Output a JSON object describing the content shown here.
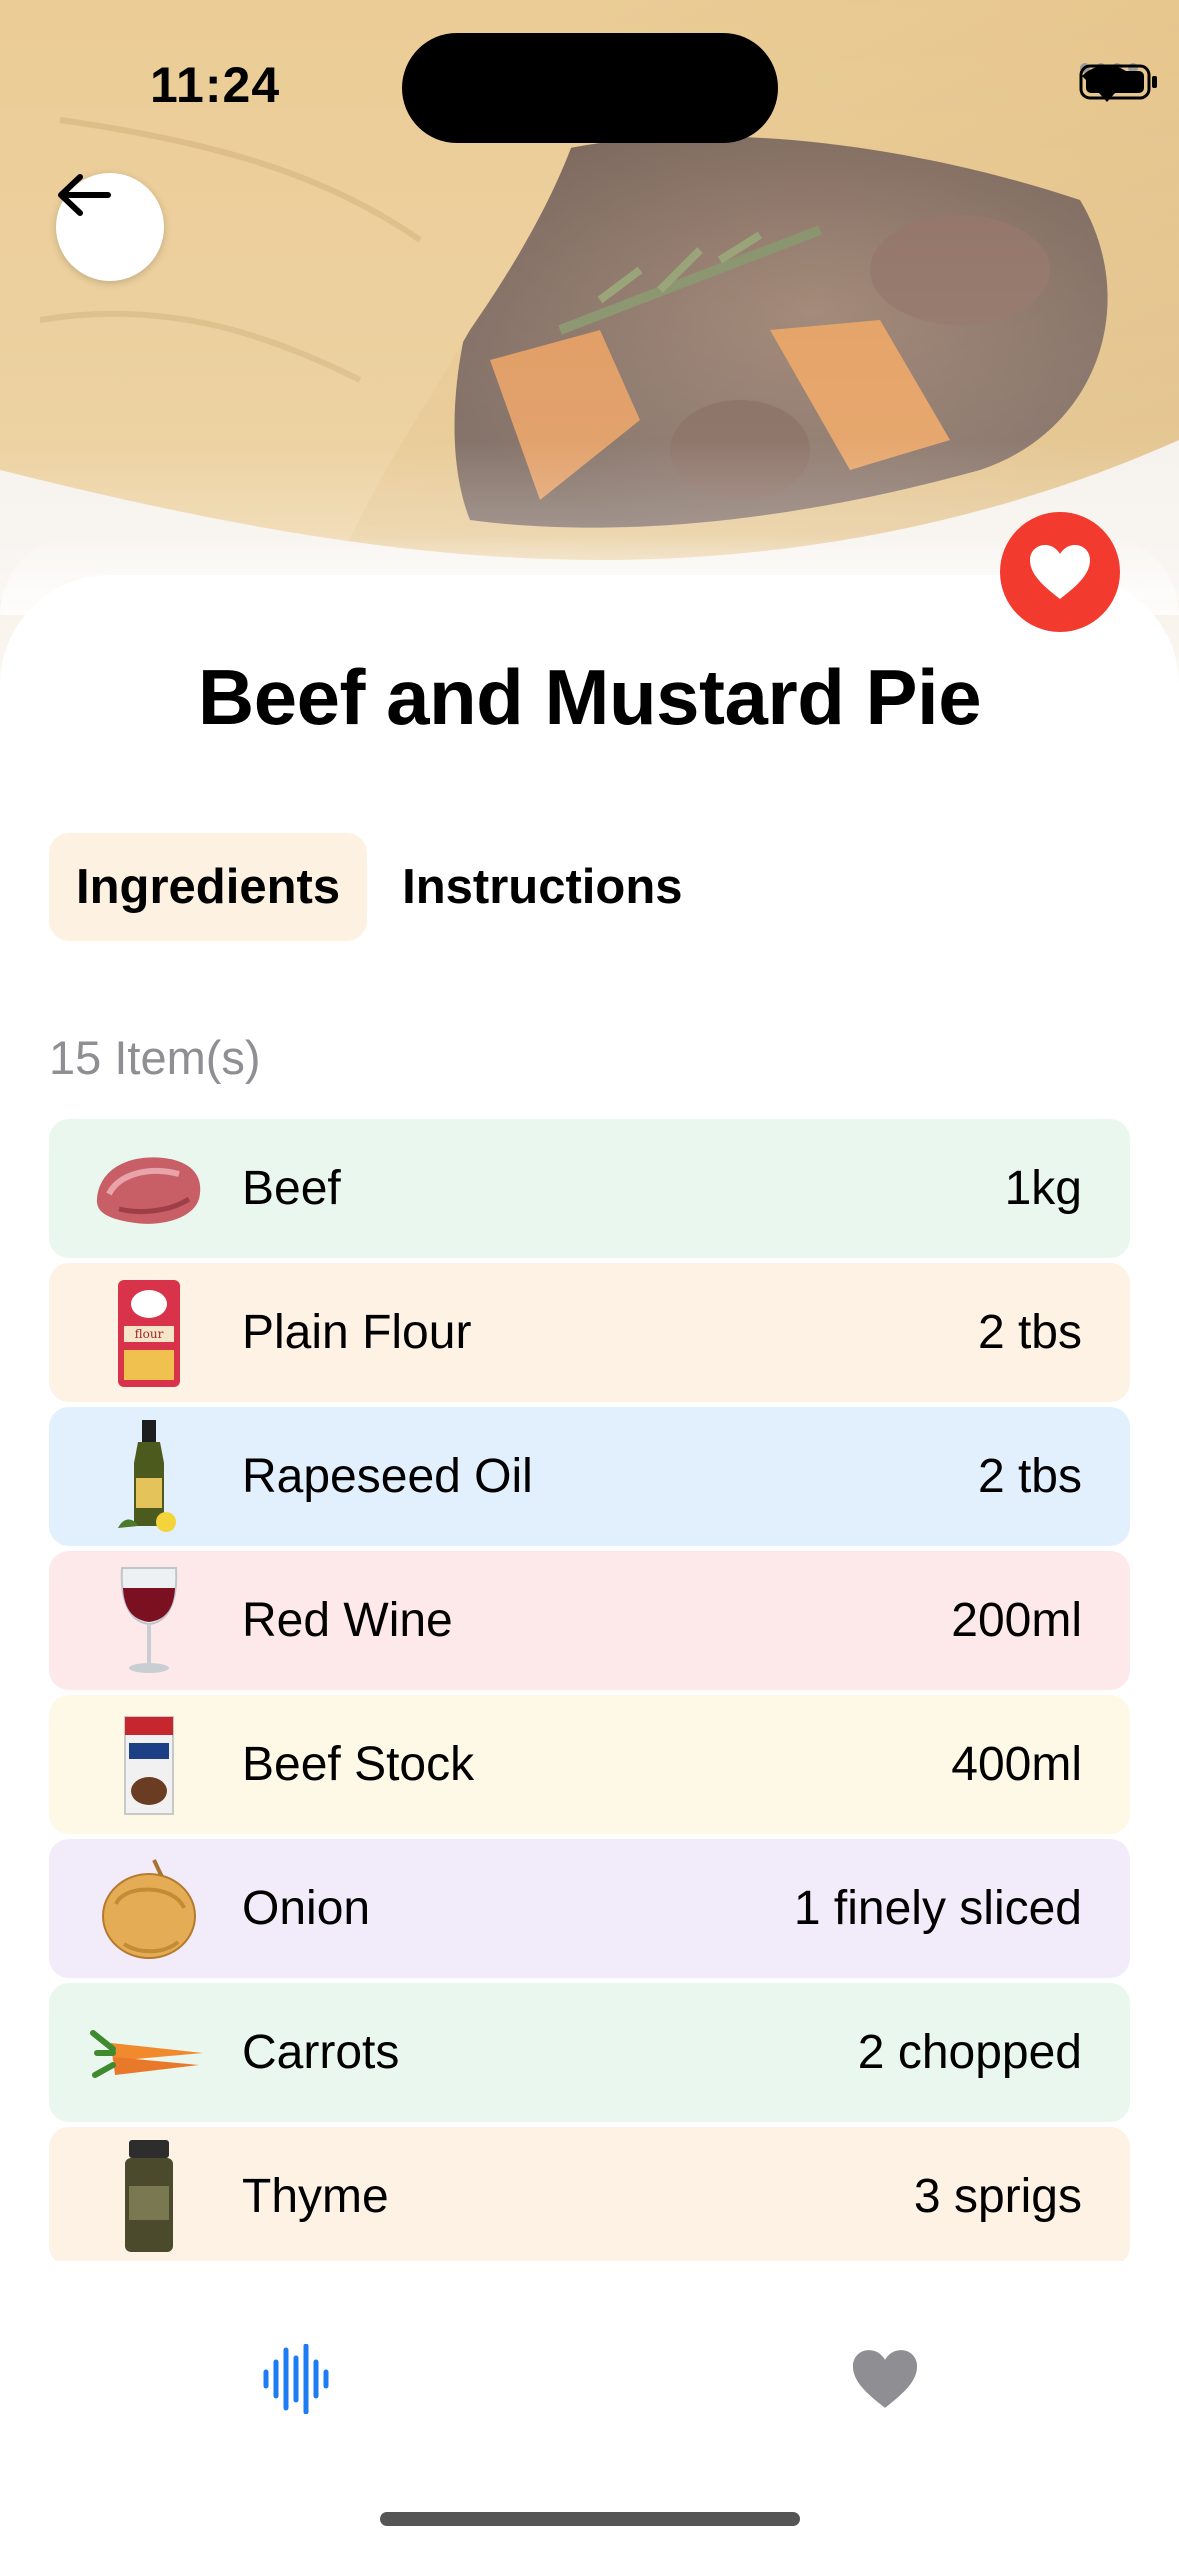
{
  "status_bar": {
    "time": "11:24"
  },
  "recipe": {
    "title": "Beef and Mustard Pie"
  },
  "tabs": [
    {
      "label": "Ingredients",
      "active": true
    },
    {
      "label": "Instructions",
      "active": false
    }
  ],
  "ingredients": {
    "count_label": "15 Item(s)",
    "items": [
      {
        "name": "Beef",
        "quantity": "1kg",
        "icon": "beef-icon",
        "color": "#eaf7ee"
      },
      {
        "name": "Plain Flour",
        "quantity": "2 tbs",
        "icon": "flour-bag-icon",
        "color": "#fdf2e4"
      },
      {
        "name": "Rapeseed Oil",
        "quantity": "2 tbs",
        "icon": "oil-bottle-icon",
        "color": "#e2effd"
      },
      {
        "name": "Red Wine",
        "quantity": "200ml",
        "icon": "wine-glass-icon",
        "color": "#fde8ea"
      },
      {
        "name": "Beef Stock",
        "quantity": "400ml",
        "icon": "stock-carton-icon",
        "color": "#fef8e6"
      },
      {
        "name": "Onion",
        "quantity": "1 finely sliced",
        "icon": "onion-icon",
        "color": "#f2ebfa"
      },
      {
        "name": "Carrots",
        "quantity": "2 chopped",
        "icon": "carrots-icon",
        "color": "#eaf7ee"
      },
      {
        "name": "Thyme",
        "quantity": "3 sprigs",
        "icon": "thyme-jar-icon",
        "color": "#fdf2e4"
      }
    ]
  },
  "colors": {
    "accent_red": "#f33a2f",
    "tab_active_bg": "#fdf1e2",
    "tabbar_active": "#1e7cf2",
    "tabbar_inactive": "#8e8e93"
  },
  "tabbar": [
    {
      "icon": "waveform-icon",
      "active": true
    },
    {
      "icon": "heart-icon",
      "active": false
    }
  ]
}
